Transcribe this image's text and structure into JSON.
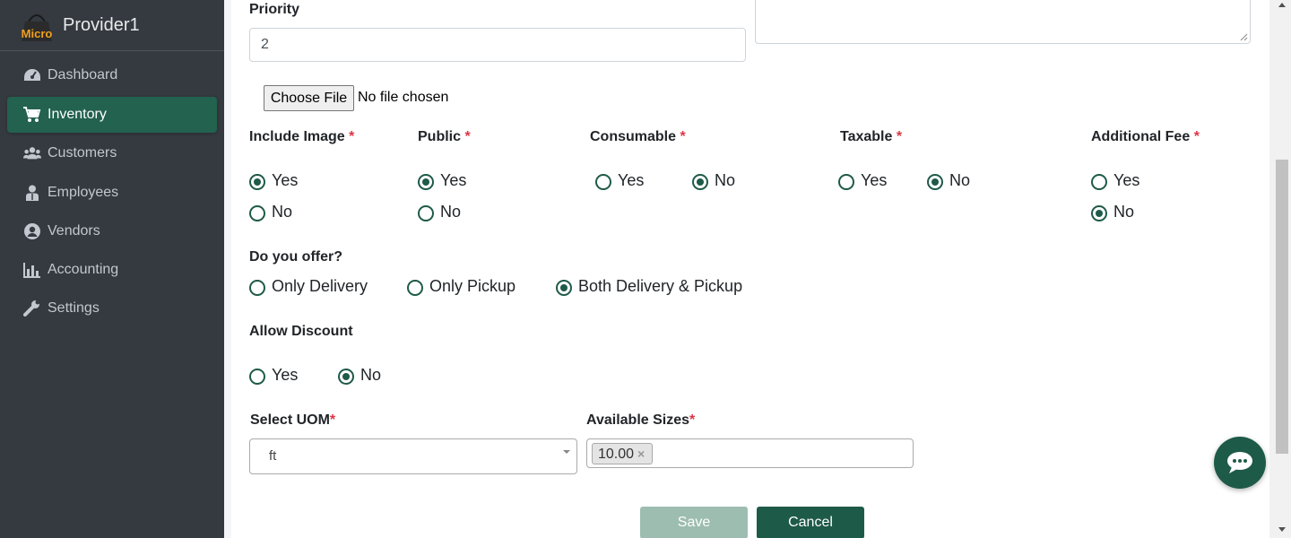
{
  "brand": {
    "name": "Provider1",
    "logo_text": "Micro"
  },
  "sidebar": {
    "items": [
      {
        "label": "Dashboard",
        "icon": "dashboard-icon",
        "active": false
      },
      {
        "label": "Inventory",
        "icon": "cart-icon",
        "active": true
      },
      {
        "label": "Customers",
        "icon": "users-icon",
        "active": false
      },
      {
        "label": "Employees",
        "icon": "employee-icon",
        "active": false
      },
      {
        "label": "Vendors",
        "icon": "user-circle-icon",
        "active": false
      },
      {
        "label": "Accounting",
        "icon": "chart-bar-icon",
        "active": false
      },
      {
        "label": "Settings",
        "icon": "wrench-icon",
        "active": false
      }
    ]
  },
  "form": {
    "priority": {
      "label": "Priority",
      "value": "2"
    },
    "file": {
      "button": "Choose File",
      "status": "No file chosen"
    },
    "include_image": {
      "label": "Include Image",
      "required": "*",
      "yes": "Yes",
      "no": "No",
      "selected": "Yes"
    },
    "public": {
      "label": "Public",
      "required": "*",
      "yes": "Yes",
      "no": "No",
      "selected": "Yes"
    },
    "consumable": {
      "label": "Consumable",
      "required": "*",
      "yes": "Yes",
      "no": "No",
      "selected": "No"
    },
    "taxable": {
      "label": "Taxable",
      "required": "*",
      "yes": "Yes",
      "no": "No",
      "selected": "No"
    },
    "additional_fee": {
      "label": "Additional Fee",
      "required": "*",
      "yes": "Yes",
      "no": "No",
      "selected": "No"
    },
    "offer": {
      "label": "Do you offer?",
      "options": [
        "Only Delivery",
        "Only Pickup",
        "Both Delivery & Pickup"
      ],
      "selected": "Both Delivery & Pickup"
    },
    "discount": {
      "label": "Allow Discount",
      "yes": "Yes",
      "no": "No",
      "selected": "No"
    },
    "uom": {
      "label": "Select UOM",
      "required": "*",
      "value": "ft"
    },
    "sizes": {
      "label": "Available Sizes",
      "required": "*",
      "tags": [
        "10.00"
      ],
      "remove": "×"
    },
    "actions": {
      "save": "Save",
      "cancel": "Cancel"
    }
  },
  "colors": {
    "sidebar_bg": "#343a40",
    "accent": "#22624f",
    "save_disabled": "#9dbdb1",
    "required": "#dc3545"
  }
}
